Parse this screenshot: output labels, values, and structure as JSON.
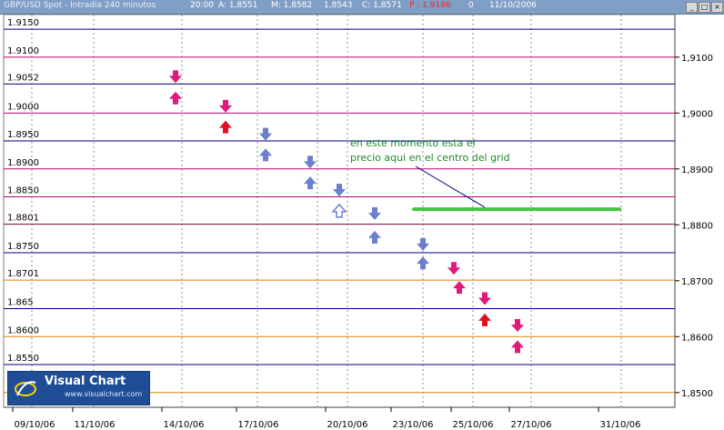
{
  "window": {
    "title": "GBP/USD Spot - Intradia 240 minutos",
    "time": "20:00",
    "open": "A: 1,8551",
    "high": "M: 1,8582",
    "low": "1,8543",
    "close": "C: 1,8571",
    "p_value": "P : 1,9196",
    "count": "0",
    "date": "11/10/2006",
    "buttons": [
      "minimize",
      "restore",
      "close"
    ]
  },
  "chart_data": {
    "type": "line",
    "y_ticks_left": [
      "1.9150",
      "1.9100",
      "1.9052",
      "1.9000",
      "1.8950",
      "1.8900",
      "1.8850",
      "1.8801",
      "1.8750",
      "1.8701",
      "1.865",
      "1.8600",
      "1.8550",
      "1.8500"
    ],
    "y_ticks_right": [
      "1,9100",
      "1,9000",
      "1,8900",
      "1,8800",
      "1,8700",
      "1,8600",
      "1,8500"
    ],
    "x_ticks": [
      "09/10/06",
      "11/10/06",
      "14/10/06",
      "17/10/06",
      "20/10/06",
      "23/10/06",
      "25/10/06",
      "27/10/06",
      "31/10/06"
    ],
    "ylim": [
      1.8485,
      1.9155
    ],
    "levels": [
      {
        "value": 1.915,
        "color": "#000080"
      },
      {
        "value": 1.91,
        "color": "#c0007a"
      },
      {
        "value": 1.9052,
        "color": "#000080"
      },
      {
        "value": 1.9,
        "color": "#c0007a"
      },
      {
        "value": 1.895,
        "color": "#000080"
      },
      {
        "value": 1.89,
        "color": "#c0007a"
      },
      {
        "value": 1.885,
        "color": "#c0007a"
      },
      {
        "value": 1.8801,
        "color": "#7a0040"
      },
      {
        "value": 1.875,
        "color": "#000080"
      },
      {
        "value": 1.8701,
        "color": "#e08000"
      },
      {
        "value": 1.865,
        "color": "#000080"
      },
      {
        "value": 1.86,
        "color": "#e08000"
      },
      {
        "value": 1.855,
        "color": "#000080"
      },
      {
        "value": 1.85,
        "color": "#e08000"
      }
    ],
    "arrows": [
      {
        "x": 193,
        "y": 1.9065,
        "dir": "down",
        "color": "#e0197f"
      },
      {
        "x": 193,
        "y": 1.9027,
        "dir": "up",
        "color": "#e0197f"
      },
      {
        "x": 248,
        "y": 1.9012,
        "dir": "down",
        "color": "#e0197f"
      },
      {
        "x": 248,
        "y": 1.8975,
        "dir": "up",
        "color": "#e01020"
      },
      {
        "x": 292,
        "y": 1.8962,
        "dir": "down",
        "color": "#6b7fcc"
      },
      {
        "x": 292,
        "y": 1.8925,
        "dir": "up",
        "color": "#6b7fcc"
      },
      {
        "x": 341,
        "y": 1.8912,
        "dir": "down",
        "color": "#6b7fcc"
      },
      {
        "x": 341,
        "y": 1.8875,
        "dir": "up",
        "color": "#6b7fcc"
      },
      {
        "x": 373,
        "y": 1.8862,
        "dir": "down",
        "color": "#6b7fcc"
      },
      {
        "x": 373,
        "y": 1.8825,
        "dir": "up-hollow",
        "color": "#6b7fcc"
      },
      {
        "x": 412,
        "y": 1.882,
        "dir": "down",
        "color": "#6b7fcc"
      },
      {
        "x": 412,
        "y": 1.8778,
        "dir": "up",
        "color": "#6b7fcc"
      },
      {
        "x": 465,
        "y": 1.8765,
        "dir": "down",
        "color": "#6b7fcc"
      },
      {
        "x": 465,
        "y": 1.8732,
        "dir": "up",
        "color": "#6b7fcc"
      },
      {
        "x": 499,
        "y": 1.8722,
        "dir": "down",
        "color": "#e0197f"
      },
      {
        "x": 505,
        "y": 1.8688,
        "dir": "up",
        "color": "#e0197f"
      },
      {
        "x": 533,
        "y": 1.8668,
        "dir": "down",
        "color": "#e0197f"
      },
      {
        "x": 533,
        "y": 1.863,
        "dir": "up",
        "color": "#e01020"
      },
      {
        "x": 569,
        "y": 1.862,
        "dir": "down",
        "color": "#e0197f"
      },
      {
        "x": 569,
        "y": 1.8582,
        "dir": "up",
        "color": "#e0197f"
      }
    ],
    "annotation": {
      "lines": [
        "en este momento esta el",
        "precio aqui en el centro del grid"
      ],
      "green_line_value": 1.8828,
      "green_line_color": "#44c444"
    }
  },
  "logo": {
    "name": "Visual Chart",
    "url": "www.visualchart.com"
  }
}
